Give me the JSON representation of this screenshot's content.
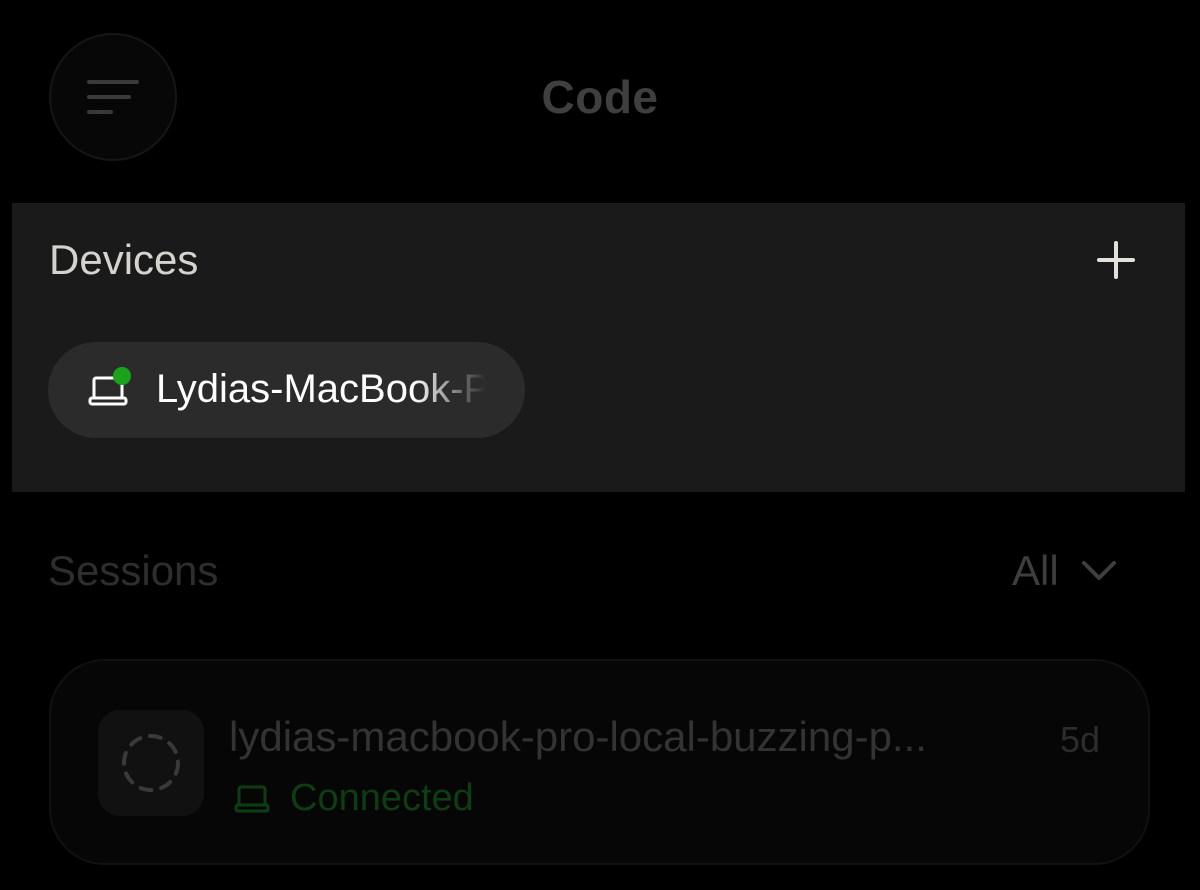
{
  "header": {
    "title": "Code",
    "menu_icon": "hamburger-menu-icon"
  },
  "devices": {
    "title": "Devices",
    "add_icon": "plus-icon",
    "items": [
      {
        "name": "Lydias-MacBook-P",
        "icon": "laptop-icon",
        "status_color": "#1aa31a"
      }
    ]
  },
  "sessions": {
    "title": "Sessions",
    "filter": {
      "selected": "All",
      "icon": "chevron-down-icon"
    },
    "items": [
      {
        "name": "lydias-macbook-pro-local-buzzing-p...",
        "age": "5d",
        "status": "Connected",
        "status_icon": "laptop-icon",
        "status_color": "#0f3d13",
        "avatar_icon": "dashed-circle-icon"
      }
    ]
  },
  "colors": {
    "background": "#000000",
    "panel": "#1a1a1a",
    "chip": "#2b2b2b",
    "online": "#1aa31a"
  }
}
